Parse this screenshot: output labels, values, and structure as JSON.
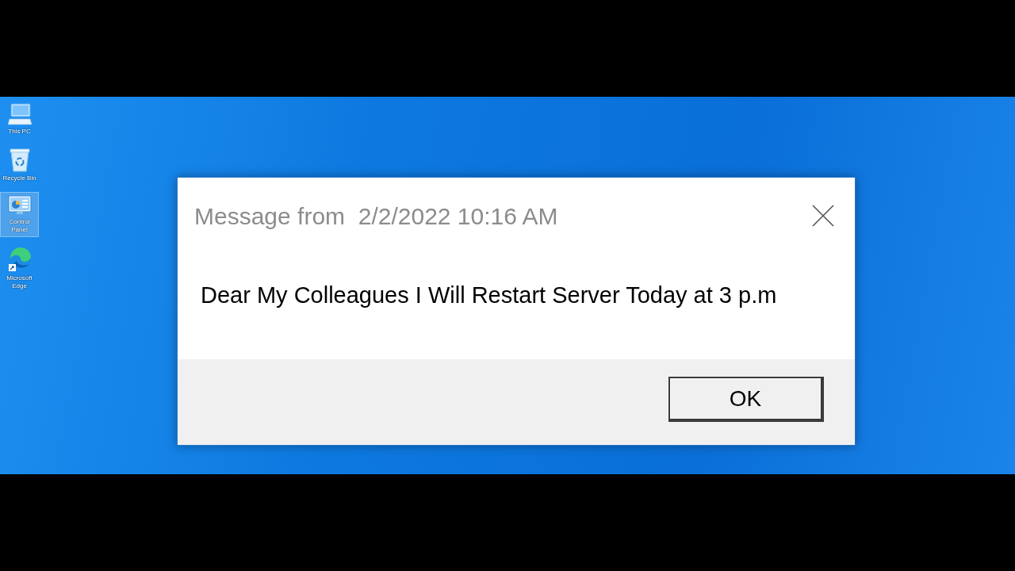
{
  "desktop": {
    "icons": [
      {
        "kind": "computer",
        "label": "This PC",
        "selected": false
      },
      {
        "kind": "recycle-bin",
        "label": "Recycle Bin",
        "selected": false
      },
      {
        "kind": "control-panel",
        "label": "Control Panel",
        "selected": true
      },
      {
        "kind": "browser",
        "label": "Microsoft Edge",
        "selected": false
      }
    ]
  },
  "dialog": {
    "title": "Message from  2/2/2022 10:16 AM",
    "message": "Dear My Colleagues I Will Restart Server Today at 3 p.m",
    "buttons": [
      "OK"
    ]
  }
}
